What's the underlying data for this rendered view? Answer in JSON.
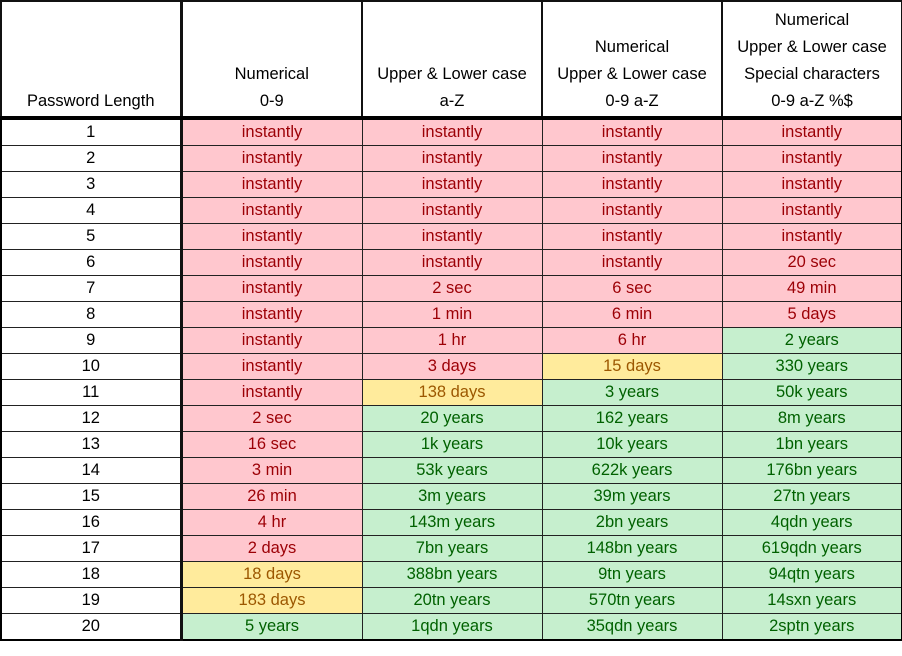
{
  "table": {
    "headers": [
      [
        "Password Length"
      ],
      [
        "Numerical",
        "0-9"
      ],
      [
        "Upper & Lower case",
        "a-Z"
      ],
      [
        "Numerical",
        "Upper & Lower case",
        "0-9 a-Z"
      ],
      [
        "Numerical",
        "Upper & Lower case",
        "Special characters",
        "0-9 a-Z %$"
      ]
    ],
    "status_colors": {
      "red": {
        "bg": "#ffc7ce",
        "text": "#9c0006"
      },
      "yellow": {
        "bg": "#ffeb9c",
        "text": "#9c5700"
      },
      "green": {
        "bg": "#c6efce",
        "text": "#006100"
      }
    },
    "rows": [
      {
        "length": "1",
        "cells": [
          [
            "instantly",
            "red"
          ],
          [
            "instantly",
            "red"
          ],
          [
            "instantly",
            "red"
          ],
          [
            "instantly",
            "red"
          ]
        ]
      },
      {
        "length": "2",
        "cells": [
          [
            "instantly",
            "red"
          ],
          [
            "instantly",
            "red"
          ],
          [
            "instantly",
            "red"
          ],
          [
            "instantly",
            "red"
          ]
        ]
      },
      {
        "length": "3",
        "cells": [
          [
            "instantly",
            "red"
          ],
          [
            "instantly",
            "red"
          ],
          [
            "instantly",
            "red"
          ],
          [
            "instantly",
            "red"
          ]
        ]
      },
      {
        "length": "4",
        "cells": [
          [
            "instantly",
            "red"
          ],
          [
            "instantly",
            "red"
          ],
          [
            "instantly",
            "red"
          ],
          [
            "instantly",
            "red"
          ]
        ]
      },
      {
        "length": "5",
        "cells": [
          [
            "instantly",
            "red"
          ],
          [
            "instantly",
            "red"
          ],
          [
            "instantly",
            "red"
          ],
          [
            "instantly",
            "red"
          ]
        ]
      },
      {
        "length": "6",
        "cells": [
          [
            "instantly",
            "red"
          ],
          [
            "instantly",
            "red"
          ],
          [
            "instantly",
            "red"
          ],
          [
            "20 sec",
            "red"
          ]
        ]
      },
      {
        "length": "7",
        "cells": [
          [
            "instantly",
            "red"
          ],
          [
            "2 sec",
            "red"
          ],
          [
            "6 sec",
            "red"
          ],
          [
            "49 min",
            "red"
          ]
        ]
      },
      {
        "length": "8",
        "cells": [
          [
            "instantly",
            "red"
          ],
          [
            "1 min",
            "red"
          ],
          [
            "6 min",
            "red"
          ],
          [
            "5 days",
            "red"
          ]
        ]
      },
      {
        "length": "9",
        "cells": [
          [
            "instantly",
            "red"
          ],
          [
            "1 hr",
            "red"
          ],
          [
            "6 hr",
            "red"
          ],
          [
            "2 years",
            "green"
          ]
        ]
      },
      {
        "length": "10",
        "cells": [
          [
            "instantly",
            "red"
          ],
          [
            "3 days",
            "red"
          ],
          [
            "15 days",
            "yellow"
          ],
          [
            "330 years",
            "green"
          ]
        ]
      },
      {
        "length": "11",
        "cells": [
          [
            "instantly",
            "red"
          ],
          [
            "138 days",
            "yellow"
          ],
          [
            "3 years",
            "green"
          ],
          [
            "50k years",
            "green"
          ]
        ]
      },
      {
        "length": "12",
        "cells": [
          [
            "2 sec",
            "red"
          ],
          [
            "20 years",
            "green"
          ],
          [
            "162 years",
            "green"
          ],
          [
            "8m years",
            "green"
          ]
        ]
      },
      {
        "length": "13",
        "cells": [
          [
            "16 sec",
            "red"
          ],
          [
            "1k years",
            "green"
          ],
          [
            "10k years",
            "green"
          ],
          [
            "1bn years",
            "green"
          ]
        ]
      },
      {
        "length": "14",
        "cells": [
          [
            "3 min",
            "red"
          ],
          [
            "53k years",
            "green"
          ],
          [
            "622k years",
            "green"
          ],
          [
            "176bn years",
            "green"
          ]
        ]
      },
      {
        "length": "15",
        "cells": [
          [
            "26 min",
            "red"
          ],
          [
            "3m years",
            "green"
          ],
          [
            "39m years",
            "green"
          ],
          [
            "27tn years",
            "green"
          ]
        ]
      },
      {
        "length": "16",
        "cells": [
          [
            "4 hr",
            "red"
          ],
          [
            "143m years",
            "green"
          ],
          [
            "2bn years",
            "green"
          ],
          [
            "4qdn years",
            "green"
          ]
        ]
      },
      {
        "length": "17",
        "cells": [
          [
            "2 days",
            "red"
          ],
          [
            "7bn years",
            "green"
          ],
          [
            "148bn years",
            "green"
          ],
          [
            "619qdn years",
            "green"
          ]
        ]
      },
      {
        "length": "18",
        "cells": [
          [
            "18 days",
            "yellow"
          ],
          [
            "388bn years",
            "green"
          ],
          [
            "9tn years",
            "green"
          ],
          [
            "94qtn years",
            "green"
          ]
        ]
      },
      {
        "length": "19",
        "cells": [
          [
            "183 days",
            "yellow"
          ],
          [
            "20tn years",
            "green"
          ],
          [
            "570tn years",
            "green"
          ],
          [
            "14sxn years",
            "green"
          ]
        ]
      },
      {
        "length": "20",
        "cells": [
          [
            "5 years",
            "green"
          ],
          [
            "1qdn years",
            "green"
          ],
          [
            "35qdn years",
            "green"
          ],
          [
            "2sptn years",
            "green"
          ]
        ]
      }
    ]
  }
}
